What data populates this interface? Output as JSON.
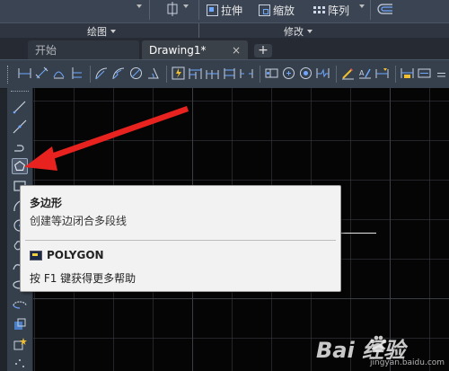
{
  "ribbon": {
    "buttons": [
      {
        "label": "拉伸",
        "icon": "stretch-icon"
      },
      {
        "label": "缩放",
        "icon": "scale-icon"
      },
      {
        "label": "阵列",
        "icon": "array-icon"
      }
    ],
    "panels": [
      {
        "label": "绘图"
      },
      {
        "label": "修改"
      }
    ]
  },
  "tabs": [
    {
      "label": "开始",
      "active": false
    },
    {
      "label": "Drawing1*",
      "active": true,
      "close": "×"
    }
  ],
  "new_tab": "+",
  "tooltip": {
    "title": "多边形",
    "description": "创建等边闭合多段线",
    "command": "POLYGON",
    "help": "按 F1 键获得更多帮助"
  },
  "watermark": {
    "text": "Bai 经验",
    "url": "jingyan.baidu.com"
  },
  "colors": {
    "ribbon_bg": "#3b4453",
    "toolbar_bg": "#36404d",
    "canvas_bg": "#050505",
    "tooltip_bg": "#f2f2f2",
    "arrow": "#e8231f",
    "icon_blue": "#6fa8ff"
  }
}
